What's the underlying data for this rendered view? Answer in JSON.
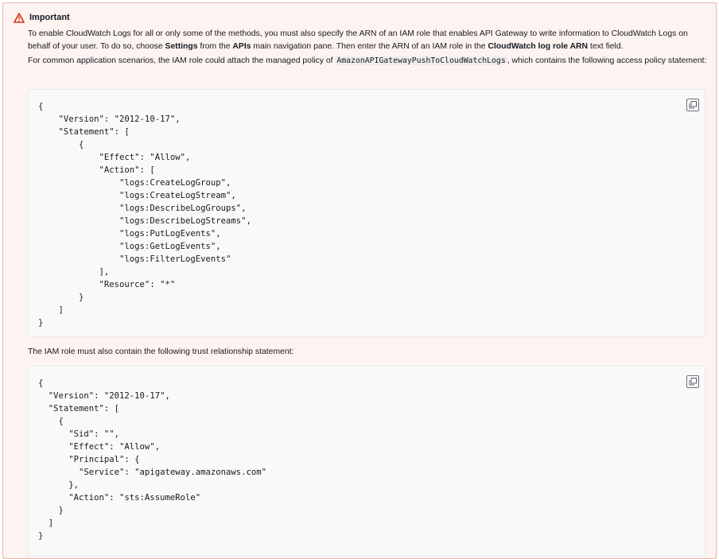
{
  "alert": {
    "title": "Important",
    "p1": {
      "t1": "To enable CloudWatch Logs for all or only some of the methods, you must also specify the ARN of an IAM role that enables API Gateway to write information to CloudWatch Logs on behalf of your user. To do so, choose ",
      "b1": "Settings",
      "t2": " from the ",
      "b2": "APIs",
      "t3": " main navigation pane. Then enter the ARN of an IAM role in the ",
      "b3": "CloudWatch log role ARN",
      "t4": " text field."
    },
    "p2": {
      "t1": "For common application scenarios, the IAM role could attach the managed policy of ",
      "code": "AmazonAPIGatewayPushToCloudWatchLogs",
      "t2": ", which contains the following access policy statement:"
    },
    "code1": "{\n    \"Version\": \"2012-10-17\",\n    \"Statement\": [\n        {\n            \"Effect\": \"Allow\",\n            \"Action\": [\n                \"logs:CreateLogGroup\",\n                \"logs:CreateLogStream\",\n                \"logs:DescribeLogGroups\",\n                \"logs:DescribeLogStreams\",\n                \"logs:PutLogEvents\",\n                \"logs:GetLogEvents\",\n                \"logs:FilterLogEvents\"\n            ],\n            \"Resource\": \"*\"\n        }\n    ]\n}",
    "p3": "The IAM role must also contain the following trust relationship statement:",
    "code2": "{\n  \"Version\": \"2012-10-17\",\n  \"Statement\": [\n    {\n      \"Sid\": \"\",\n      \"Effect\": \"Allow\",\n      \"Principal\": {\n        \"Service\": \"apigateway.amazonaws.com\"\n      },\n      \"Action\": \"sts:AssumeRole\"\n    }\n  ]\n}"
  },
  "icons": {
    "alert": "warning-triangle-icon",
    "copy": "copy-icon"
  },
  "colors": {
    "alert_background": "#fdf3f1",
    "alert_border": "#e8b7ae",
    "warning_icon": "#d13212",
    "code_background": "#f9f9f9"
  }
}
